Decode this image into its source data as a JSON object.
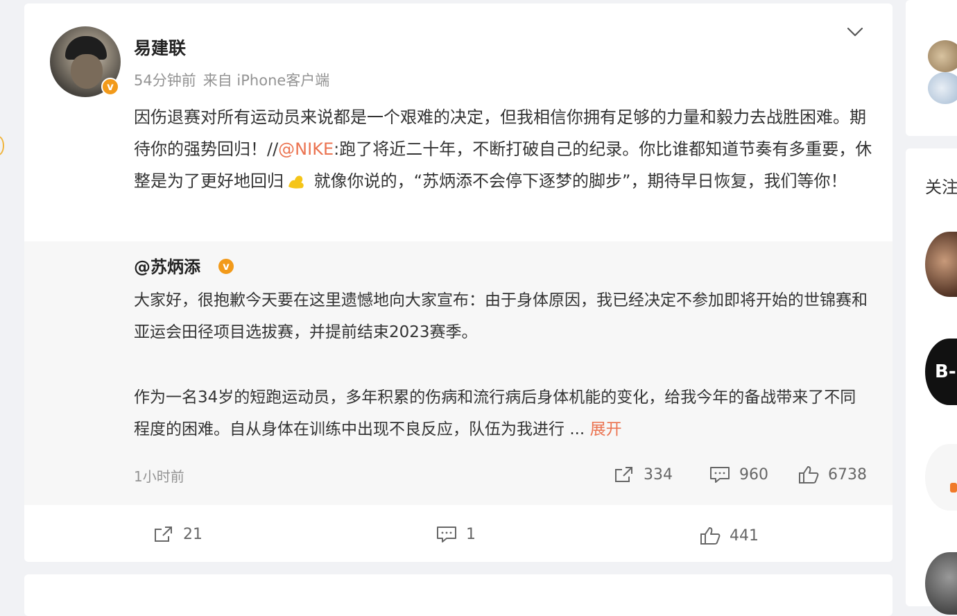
{
  "post": {
    "author": "易建联",
    "time": "54分钟前",
    "source": "来自 iPhone客户端",
    "text_1": "因伤退赛对所有运动员来说都是一个艰难的决定，但我相信你拥有足够的力量和毅力去战胜困难。期待你的强势回归！//",
    "mention": "@NIKE",
    "text_2": ":跑了将近二十年，不断打破自己的纪录。你比谁都知道节奏有多重要，休整是为了更好地回归",
    "emoji_icon": "flexed-biceps-emoji",
    "text_3": " 就像你说的，“苏炳添不会停下逐梦的脚步”，期待早日恢复，我们等你！",
    "actions": {
      "repost_count": "21",
      "comment_count": "1",
      "like_count": "441"
    }
  },
  "repost": {
    "author": "@苏炳添",
    "paragraph_1": "大家好，很抱歉今天要在这里遗憾地向大家宣布：由于身体原因，我已经决定不参加即将开始的世锦赛和亚运会田径项目选拔赛，并提前结束2023赛季。",
    "paragraph_2": "作为一名34岁的短跑运动员，多年积累的伤病和流行病后身体机能的变化，给我今年的备战带来了不同程度的困难。自从身体在训练中出现不良反应，队伍为我进行",
    "ellipsis": "...",
    "expand_label": "展开",
    "time": "1小时前",
    "repost_count": "334",
    "comment_count": "960",
    "like_count": "6738"
  },
  "sidebar": {
    "follow_label": "关注",
    "b_avatar_text": "B-"
  },
  "colors": {
    "accent": "#eb7350",
    "verified_badge": "#f29a1a",
    "repost_bg": "#f7f7f7"
  }
}
